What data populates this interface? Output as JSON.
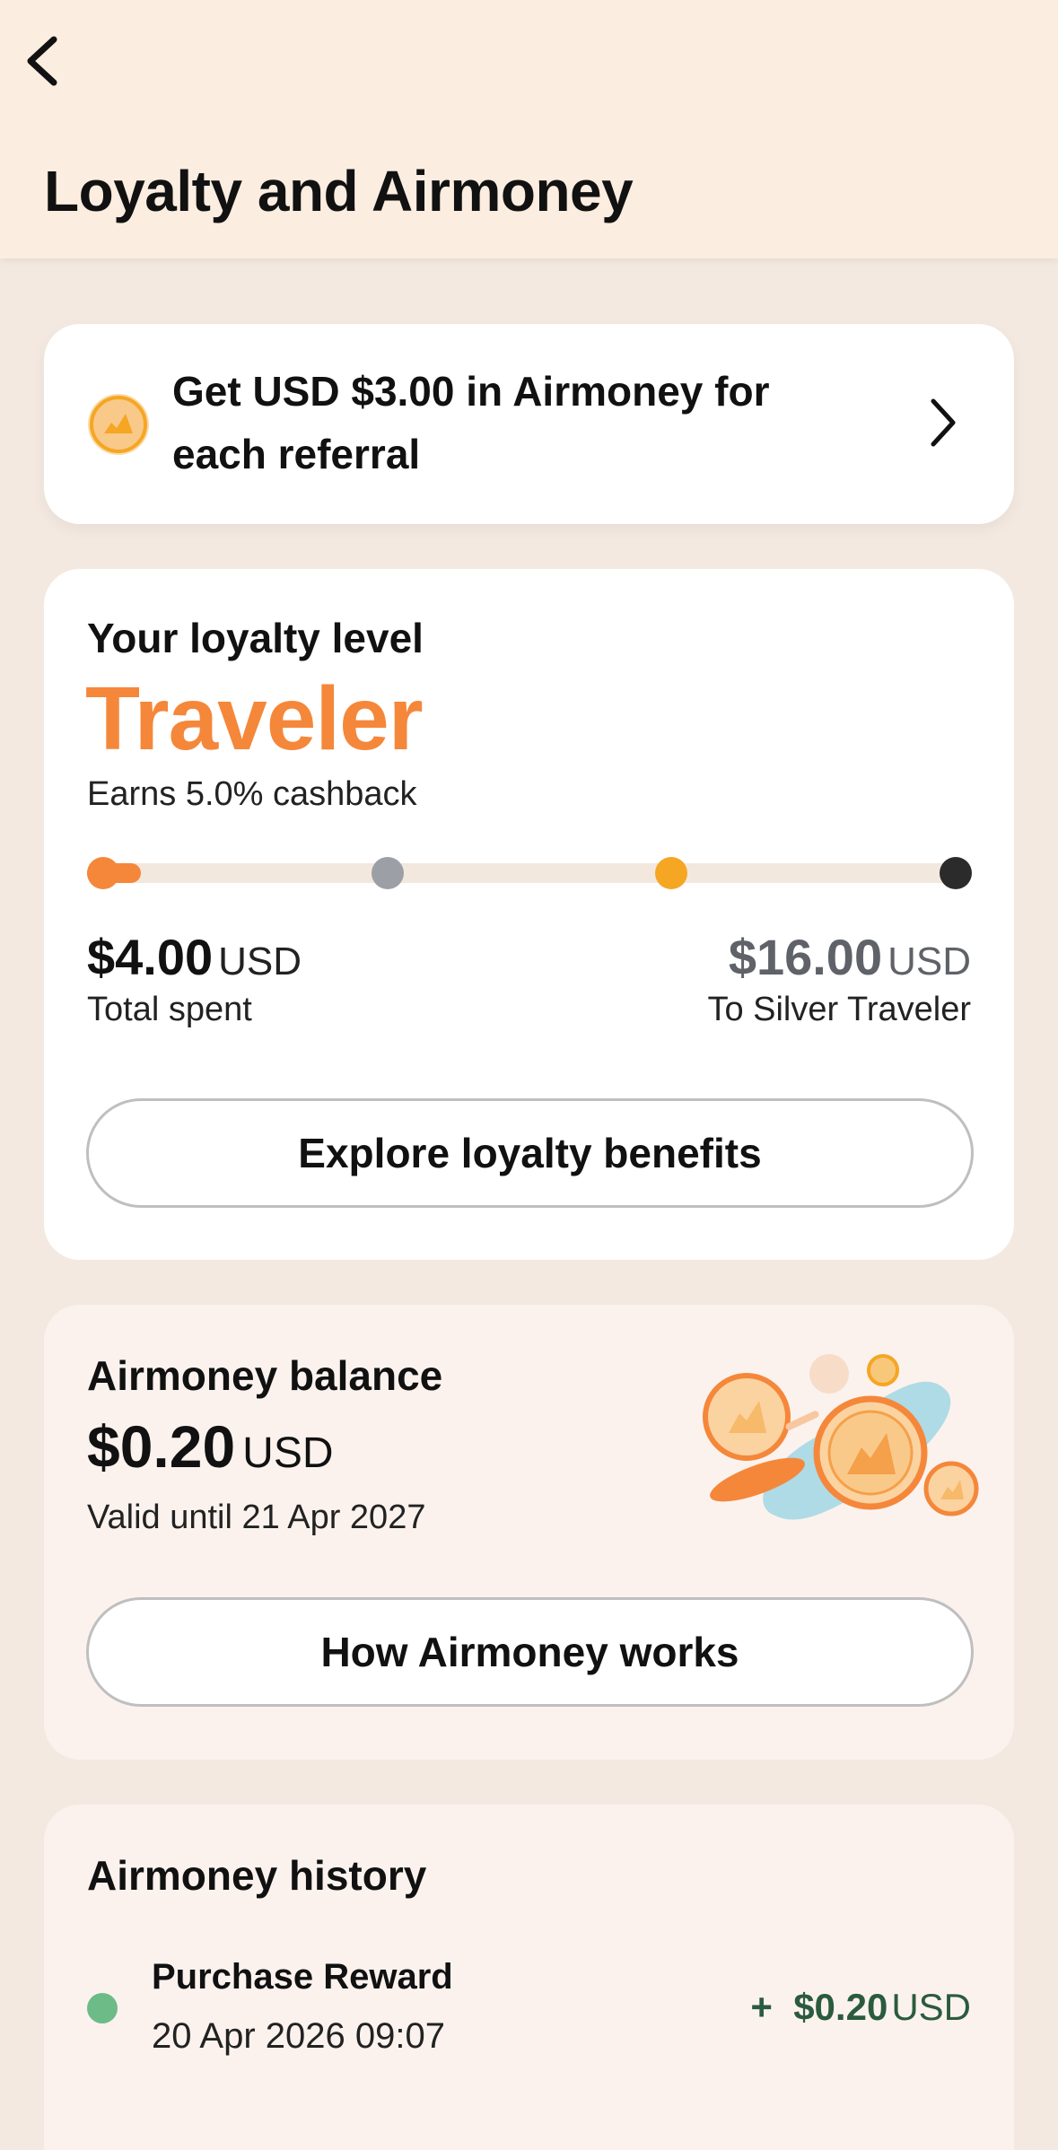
{
  "header": {
    "title": "Loyalty and Airmoney"
  },
  "referral": {
    "text": "Get USD $3.00 in Airmoney for each referral"
  },
  "loyalty": {
    "label": "Your loyalty level",
    "level": "Traveler",
    "cashback": "Earns 5.0% cashback",
    "progress_fraction": 0.05,
    "milestone_colors": [
      "#f5873a",
      "#9ca0a6",
      "#f5a623",
      "#2b2b2b"
    ],
    "spent_amount": "$4.00",
    "spent_unit": "USD",
    "spent_label": "Total spent",
    "remaining_amount": "$16.00",
    "remaining_unit": "USD",
    "remaining_label": "To Silver Traveler",
    "benefits_button": "Explore loyalty benefits"
  },
  "balance": {
    "label": "Airmoney balance",
    "amount": "$0.20",
    "unit": "USD",
    "valid_until": "Valid until 21 Apr 2027",
    "how_button": "How Airmoney works"
  },
  "history": {
    "title": "Airmoney history",
    "items": [
      {
        "name": "Purchase Reward",
        "date": "20 Apr 2026 09:07",
        "sign": "+",
        "amount": "$0.20",
        "unit": "USD"
      }
    ]
  },
  "colors": {
    "accent": "#f5873a",
    "background": "#f3e9e0",
    "header": "#fbede0",
    "positive": "#2b5b3e"
  }
}
